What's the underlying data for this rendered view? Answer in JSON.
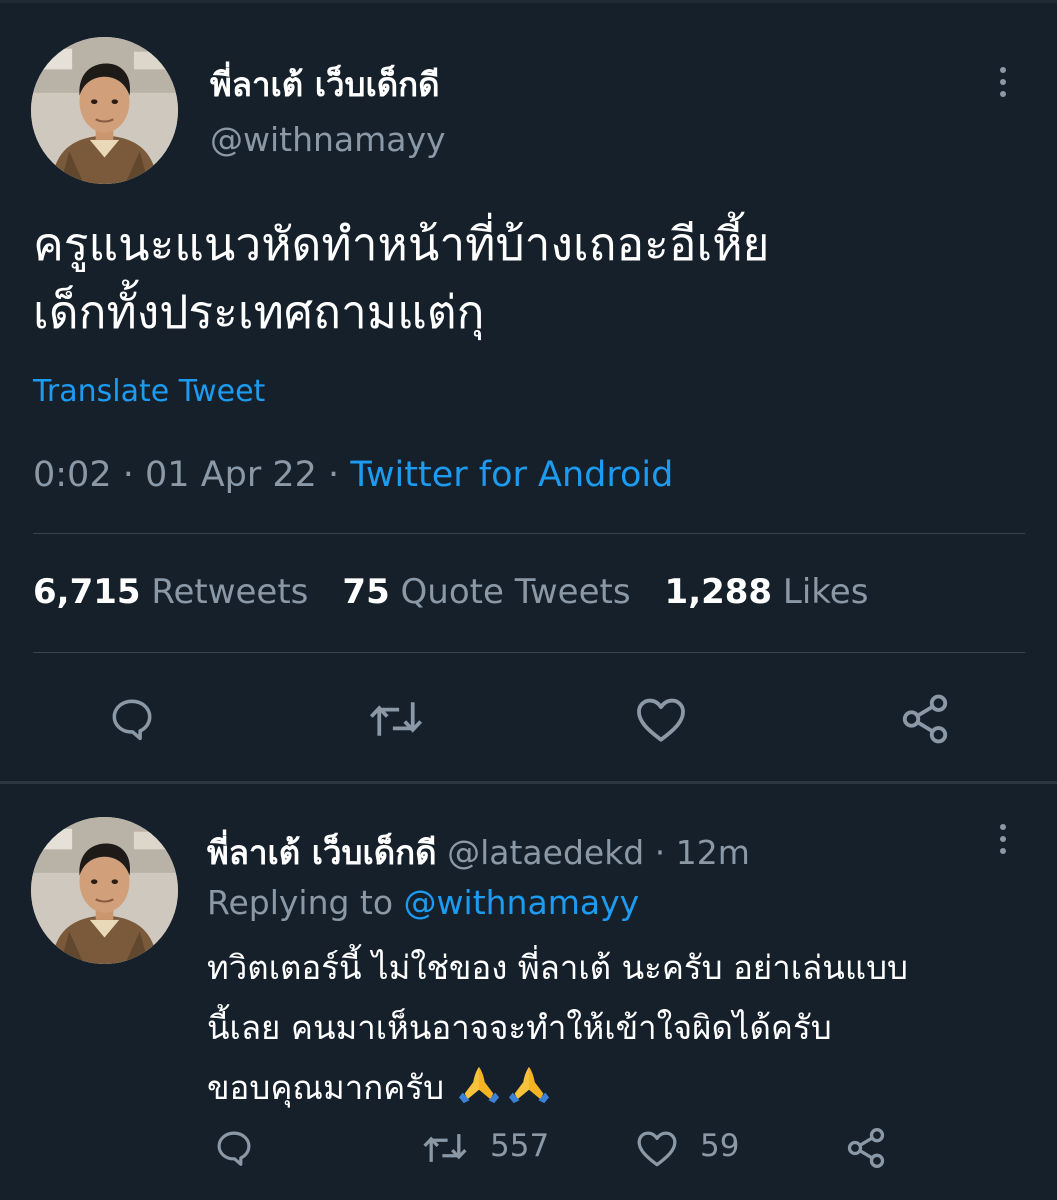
{
  "main_tweet": {
    "display_name": "พี่ลาเต้ เว็บเด็กดี",
    "handle": "@withnamayy",
    "text": "ครูแนะแนวหัดทำหน้าที่บ้างเถอะอีเหี้ย\nเด็กทั้งประเทศถามแต่กุ",
    "translate_label": "Translate Tweet",
    "time": "0:02",
    "date": "01 Apr 22",
    "separator": "·",
    "source": "Twitter for Android",
    "stats": [
      {
        "value": "6,715",
        "label": "Retweets"
      },
      {
        "value": "75",
        "label": "Quote Tweets"
      },
      {
        "value": "1,288",
        "label": "Likes"
      }
    ]
  },
  "reply": {
    "display_name": "พี่ลาเต้ เว็บเด็กดี",
    "handle": "@lataedekd",
    "separator": "·",
    "time_ago": "12m",
    "replying_prefix": "Replying to",
    "replying_to": "@withnamayy",
    "text": "ทวิตเตอร์นี้ ไม่ใช่ของ พี่ลาเต้ นะครับ อย่าเล่นแบบ\nนี้เลย คนมาเห็นอาจจะทำให้เข้าใจผิดได้ครับ\nขอบคุณมากครับ",
    "emoji": "folded-hands-icon ×2",
    "retweet_count": "557",
    "like_count": "59"
  },
  "colors": {
    "background": "#15202b",
    "text_primary": "#ffffff",
    "text_secondary": "#8b98a5",
    "link": "#1d9bf0",
    "divider": "#38444d"
  },
  "icons": [
    "avatar",
    "more-icon",
    "reply-icon",
    "retweet-icon",
    "like-icon",
    "share-icon",
    "folded-hands-icon"
  ]
}
